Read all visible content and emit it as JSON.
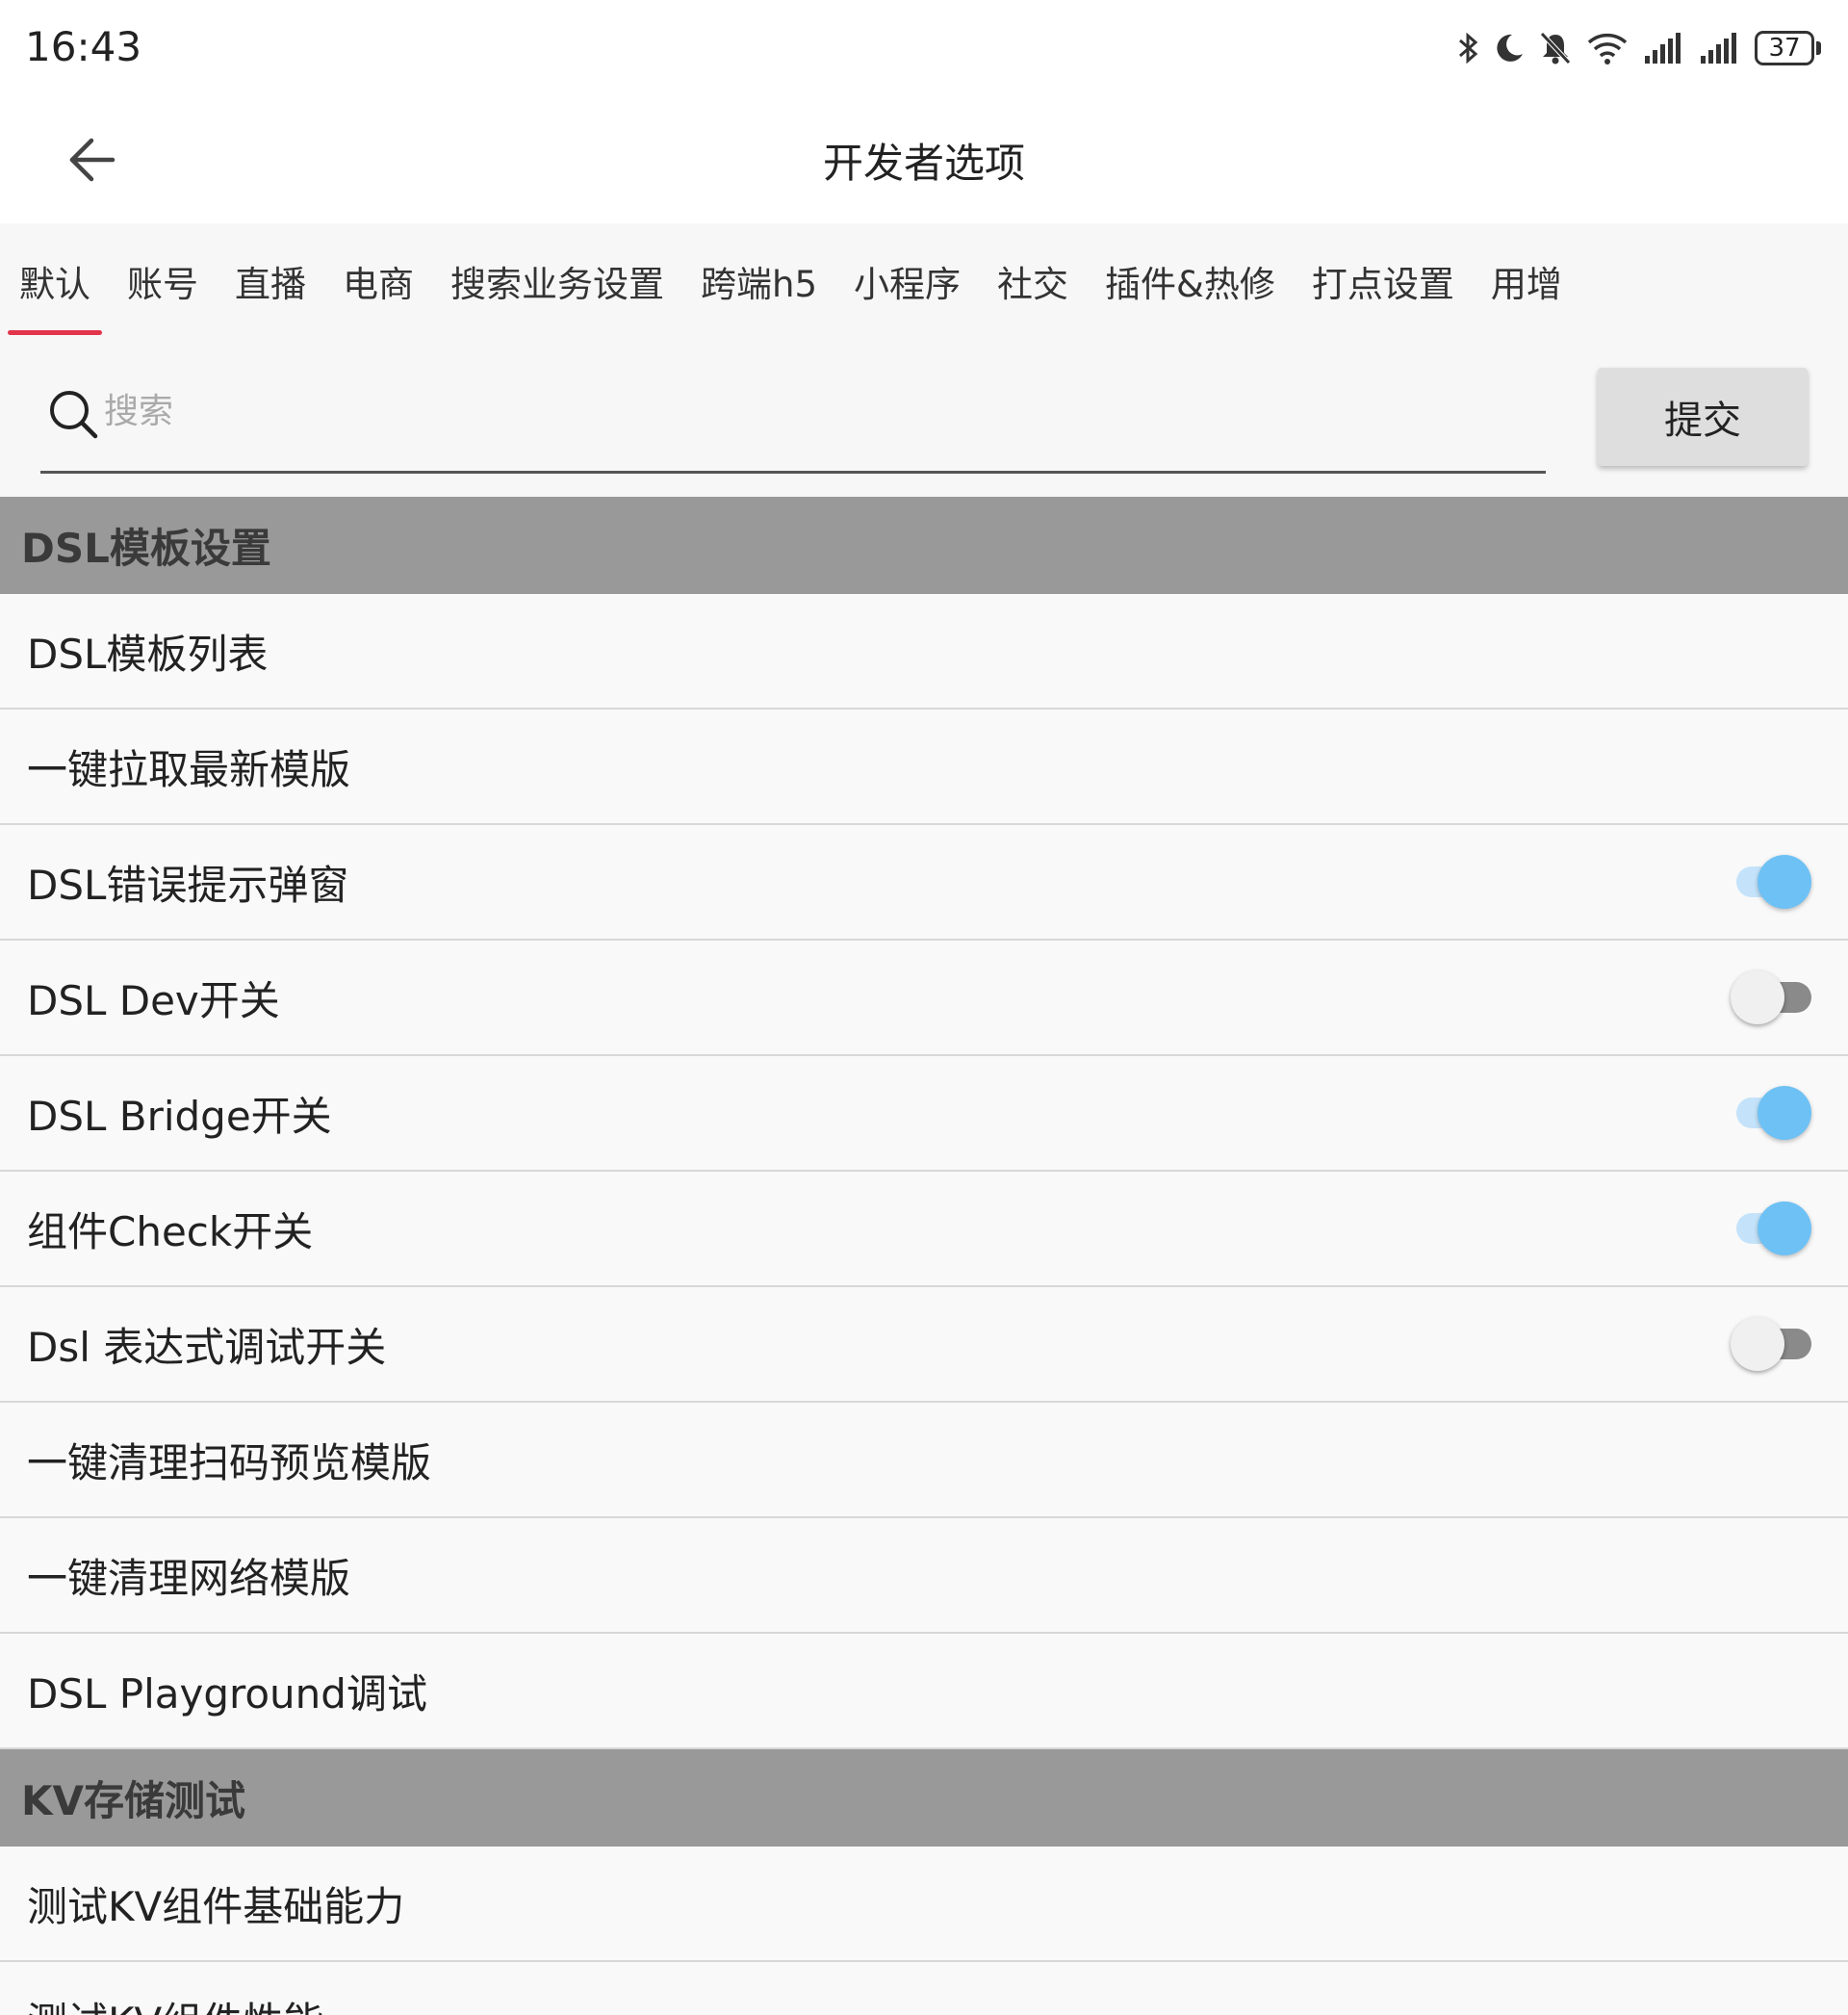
{
  "status_bar": {
    "time": "16:43",
    "battery": "37",
    "icons": [
      "bluetooth-icon",
      "moon-icon",
      "bell-off-icon",
      "wifi-icon",
      "signal-icon",
      "signal-icon",
      "battery-icon"
    ]
  },
  "app_bar": {
    "title": "开发者选项",
    "back_icon": "arrow-left-icon"
  },
  "tabs": [
    {
      "label": "默认",
      "active": true
    },
    {
      "label": "账号"
    },
    {
      "label": "直播"
    },
    {
      "label": "电商"
    },
    {
      "label": "搜索业务设置"
    },
    {
      "label": "跨端h5"
    },
    {
      "label": "小程序"
    },
    {
      "label": "社交"
    },
    {
      "label": "插件&热修"
    },
    {
      "label": "打点设置"
    },
    {
      "label": "用增"
    }
  ],
  "search": {
    "placeholder": "搜索",
    "value": "",
    "submit_label": "提交"
  },
  "colors": {
    "accent": "#e2344b",
    "toggle_on": "#6ec1f5",
    "section_bg": "#999999"
  },
  "sections": [
    {
      "title": "DSL模板设置",
      "rows": [
        {
          "label": "DSL模板列表"
        },
        {
          "label": "一键拉取最新模版"
        },
        {
          "label": "DSL错误提示弹窗",
          "toggle": true
        },
        {
          "label": "DSL Dev开关",
          "toggle": false
        },
        {
          "label": "DSL Bridge开关",
          "toggle": true
        },
        {
          "label": "组件Check开关",
          "toggle": true
        },
        {
          "label": "Dsl 表达式调试开关",
          "toggle": false
        },
        {
          "label": "一键清理扫码预览模版"
        },
        {
          "label": "一键清理网络模版"
        },
        {
          "label": "DSL Playground调试"
        }
      ]
    },
    {
      "title": "KV存储测试",
      "rows": [
        {
          "label": "测试KV组件基础能力"
        },
        {
          "label": "测试KV组件性能"
        }
      ]
    }
  ]
}
